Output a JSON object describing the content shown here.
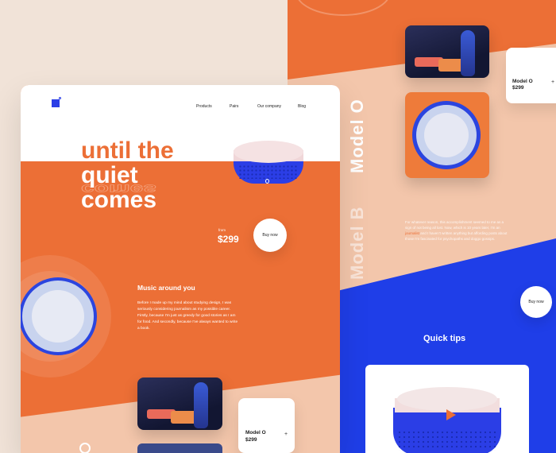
{
  "nav": {
    "items": [
      {
        "label": "Products"
      },
      {
        "label": "Pairs"
      },
      {
        "label": "Our company"
      },
      {
        "label": "Blog"
      }
    ]
  },
  "hero": {
    "line1": "until the",
    "line2": "quiet",
    "line3": "comes",
    "from": "from",
    "price": "$299",
    "buy_label": "Buy now"
  },
  "music": {
    "title": "Music around you",
    "text": "Before I made up my mind about studying design, I was seriously considering journalism as my possible career. Firstly, because I'm just as greedy for good stories as I am for food. And secondly, because I've always wanted to write a book."
  },
  "product_card": {
    "model": "Model O",
    "price": "$299",
    "plus": "+"
  },
  "right_panel": {
    "vertical_model_o": "Model O",
    "vertical_model_b": "Model B",
    "paragraph_before": "For whatever reason, this accomplishment seemed to me as a sign of not being all lost. Now, which is 10 years later, I'm an ",
    "paragraph_highlight": "journalist",
    "paragraph_after": " and I haven't written anything but affording posts about those I'm fascinated for psychopaths and doggo gossips.",
    "buy_label": "Buy now",
    "quick_tips": "Quick tips"
  },
  "colors": {
    "orange": "#ec6f36",
    "blue": "#2b3ee6",
    "peach": "#f3c6ab",
    "cream": "#f1e3d8"
  }
}
